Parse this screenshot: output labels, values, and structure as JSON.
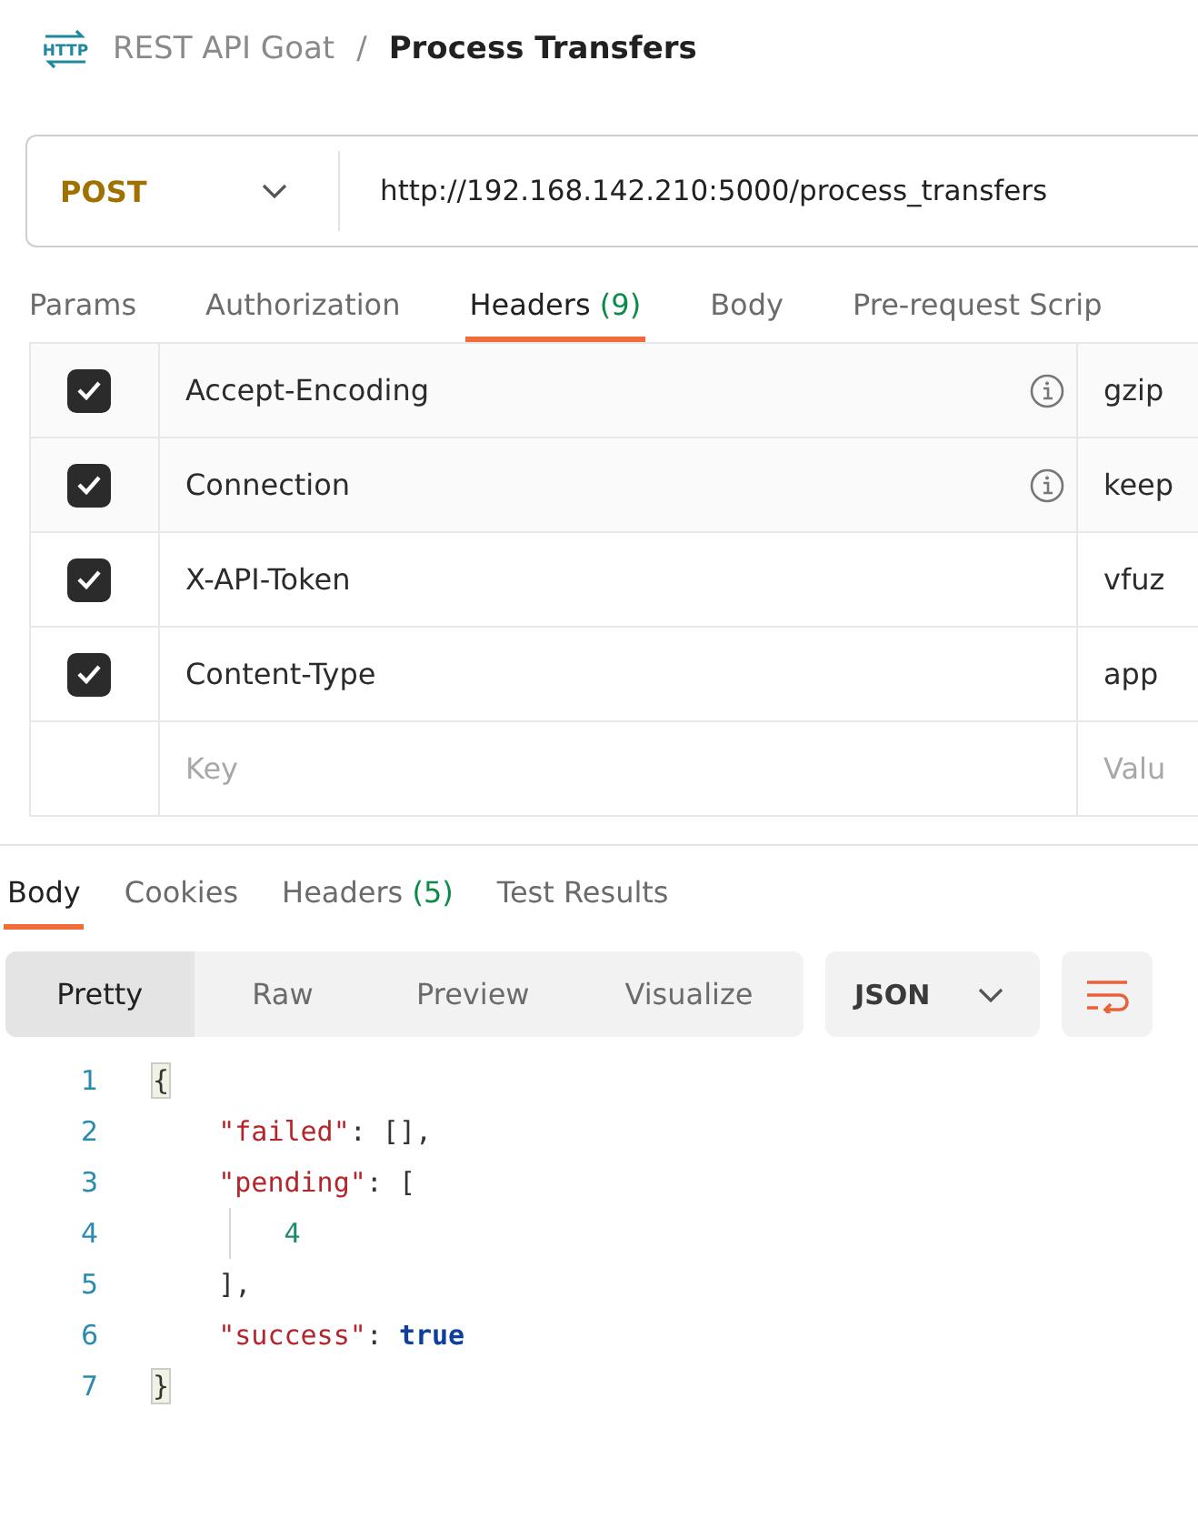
{
  "logo": "HTTP",
  "breadcrumb": {
    "collection": "REST API Goat",
    "separator": "/",
    "request": "Process Transfers"
  },
  "request_bar": {
    "method": "POST",
    "url": "http://192.168.142.210:5000/process_transfers"
  },
  "request_tabs": [
    {
      "label": "Params",
      "selected": false
    },
    {
      "label": "Authorization",
      "selected": false
    },
    {
      "label": "Headers",
      "count": "(9)",
      "selected": true
    },
    {
      "label": "Body",
      "selected": false
    },
    {
      "label": "Pre-request Scrip",
      "selected": false
    }
  ],
  "headers": [
    {
      "checked": true,
      "key": "Accept-Encoding",
      "info": true,
      "value": "gzip"
    },
    {
      "checked": true,
      "key": "Connection",
      "info": true,
      "value": "keep"
    },
    {
      "checked": true,
      "key": "X-API-Token",
      "info": false,
      "value": "vfuz"
    },
    {
      "checked": true,
      "key": "Content-Type",
      "info": false,
      "value": "app"
    }
  ],
  "new_header": {
    "key_placeholder": "Key",
    "value_placeholder": "Valu"
  },
  "response_tabs": [
    {
      "label": "Body",
      "selected": true
    },
    {
      "label": "Cookies",
      "selected": false
    },
    {
      "label": "Headers",
      "count": "(5)",
      "selected": false
    },
    {
      "label": "Test Results",
      "selected": false
    }
  ],
  "view_modes": [
    {
      "label": "Pretty",
      "selected": true
    },
    {
      "label": "Raw",
      "selected": false
    },
    {
      "label": "Preview",
      "selected": false
    },
    {
      "label": "Visualize",
      "selected": false
    }
  ],
  "format": "JSON",
  "code_lines": [
    {
      "number": "1",
      "tokens": [
        {
          "kind": "brace",
          "text": "{"
        }
      ]
    },
    {
      "number": "2",
      "tokens": [
        {
          "kind": "key",
          "text": "    \"failed\""
        },
        {
          "kind": "punct",
          "text": ": [],"
        }
      ]
    },
    {
      "number": "3",
      "tokens": [
        {
          "kind": "key",
          "text": "    \"pending\""
        },
        {
          "kind": "punct",
          "text": ": ["
        }
      ]
    },
    {
      "number": "4",
      "guide": true,
      "tokens": [
        {
          "kind": "number",
          "text": "        4"
        }
      ]
    },
    {
      "number": "5",
      "tokens": [
        {
          "kind": "punct",
          "text": "    ],"
        }
      ]
    },
    {
      "number": "6",
      "tokens": [
        {
          "kind": "key",
          "text": "    \"success\""
        },
        {
          "kind": "punct",
          "text": ": "
        },
        {
          "kind": "bool",
          "text": "true"
        }
      ]
    },
    {
      "number": "7",
      "tokens": [
        {
          "kind": "brace",
          "text": "}"
        }
      ]
    }
  ]
}
